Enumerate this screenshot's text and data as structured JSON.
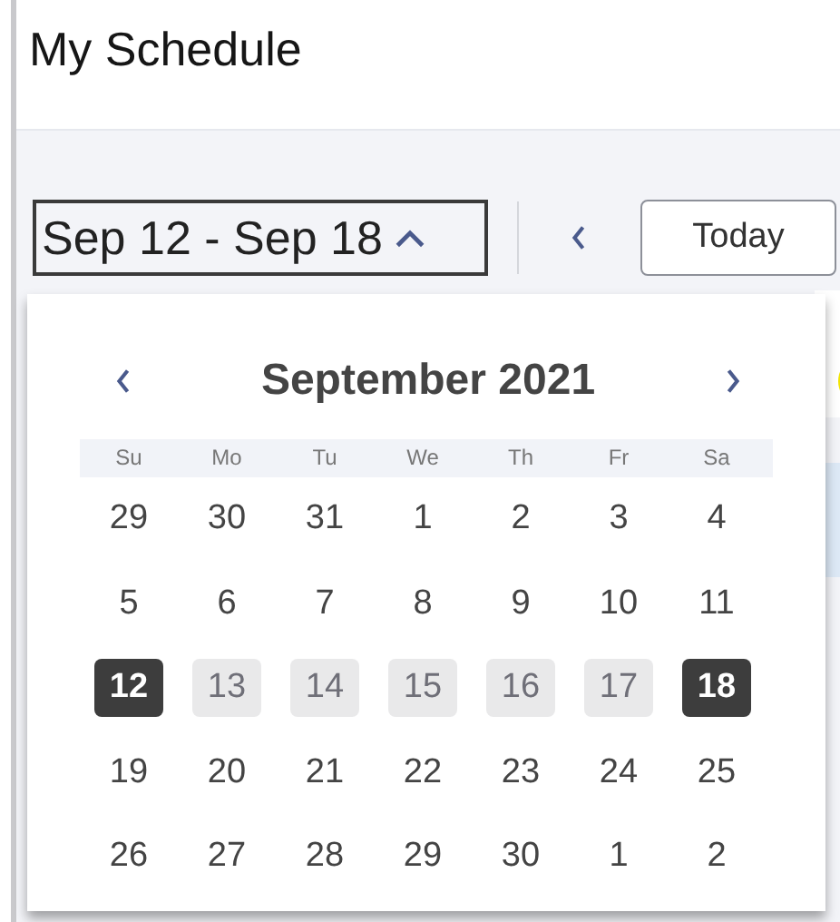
{
  "page_title": "My Schedule",
  "toolbar": {
    "date_range": "Sep 12 - Sep 18",
    "today_button": "Today"
  },
  "calendar": {
    "month": "September 2021",
    "weekdays": [
      "Su",
      "Mo",
      "Tu",
      "We",
      "Th",
      "Fr",
      "Sa"
    ],
    "weeks": [
      [
        {
          "day": "29",
          "selected": false,
          "in_range": false
        },
        {
          "day": "30",
          "selected": false,
          "in_range": false
        },
        {
          "day": "31",
          "selected": false,
          "in_range": false
        },
        {
          "day": "1",
          "selected": false,
          "in_range": false
        },
        {
          "day": "2",
          "selected": false,
          "in_range": false
        },
        {
          "day": "3",
          "selected": false,
          "in_range": false
        },
        {
          "day": "4",
          "selected": false,
          "in_range": false
        }
      ],
      [
        {
          "day": "5",
          "selected": false,
          "in_range": false
        },
        {
          "day": "6",
          "selected": false,
          "in_range": false
        },
        {
          "day": "7",
          "selected": false,
          "in_range": false
        },
        {
          "day": "8",
          "selected": false,
          "in_range": false
        },
        {
          "day": "9",
          "selected": false,
          "in_range": false
        },
        {
          "day": "10",
          "selected": false,
          "in_range": false
        },
        {
          "day": "11",
          "selected": false,
          "in_range": false
        }
      ],
      [
        {
          "day": "12",
          "selected": true,
          "in_range": false
        },
        {
          "day": "13",
          "selected": false,
          "in_range": true
        },
        {
          "day": "14",
          "selected": false,
          "in_range": true
        },
        {
          "day": "15",
          "selected": false,
          "in_range": true
        },
        {
          "day": "16",
          "selected": false,
          "in_range": true
        },
        {
          "day": "17",
          "selected": false,
          "in_range": true
        },
        {
          "day": "18",
          "selected": true,
          "in_range": false
        }
      ],
      [
        {
          "day": "19",
          "selected": false,
          "in_range": false
        },
        {
          "day": "20",
          "selected": false,
          "in_range": false
        },
        {
          "day": "21",
          "selected": false,
          "in_range": false
        },
        {
          "day": "22",
          "selected": false,
          "in_range": false
        },
        {
          "day": "23",
          "selected": false,
          "in_range": false
        },
        {
          "day": "24",
          "selected": false,
          "in_range": false
        },
        {
          "day": "25",
          "selected": false,
          "in_range": false
        }
      ],
      [
        {
          "day": "26",
          "selected": false,
          "in_range": false
        },
        {
          "day": "27",
          "selected": false,
          "in_range": false
        },
        {
          "day": "28",
          "selected": false,
          "in_range": false
        },
        {
          "day": "29",
          "selected": false,
          "in_range": false
        },
        {
          "day": "30",
          "selected": false,
          "in_range": false
        },
        {
          "day": "1",
          "selected": false,
          "in_range": false
        },
        {
          "day": "2",
          "selected": false,
          "in_range": false
        }
      ]
    ]
  }
}
